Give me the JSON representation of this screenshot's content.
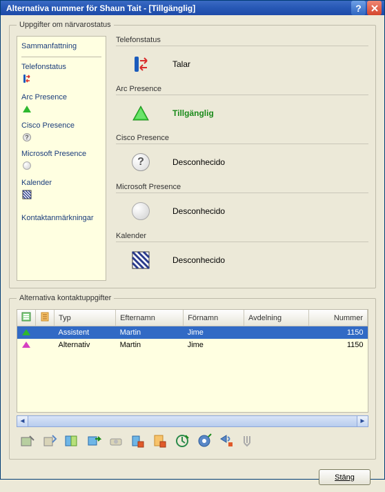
{
  "title": "Alternativa nummer för Shaun Tait - [Tillgänglig]",
  "group_presence_label": "Uppgifter om närvarostatus",
  "sidebar": {
    "summary": "Sammanfattning",
    "items": [
      {
        "label": "Telefonstatus"
      },
      {
        "label": "Arc Presence"
      },
      {
        "label": "Cisco Presence"
      },
      {
        "label": "Microsoft Presence"
      },
      {
        "label": "Kalender"
      },
      {
        "label": "Kontaktanmärkningar"
      }
    ]
  },
  "status": {
    "telefon": {
      "label": "Telefonstatus",
      "value": "Talar"
    },
    "arc": {
      "label": "Arc Presence",
      "value": "Tillgänglig"
    },
    "cisco": {
      "label": "Cisco Presence",
      "value": "Desconhecido"
    },
    "microsoft": {
      "label": "Microsoft Presence",
      "value": "Desconhecido"
    },
    "kalender": {
      "label": "Kalender",
      "value": "Desconhecido"
    }
  },
  "alt_group_label": "Alternativa kontaktuppgifter",
  "table": {
    "headers": {
      "typ": "Typ",
      "efternamn": "Efternamn",
      "fornamn": "Förnamn",
      "avdelning": "Avdelning",
      "nummer": "Nummer"
    },
    "rows": [
      {
        "typ": "Assistent",
        "efternamn": "Martin",
        "fornamn": "Jime",
        "avdelning": "",
        "nummer": "1150",
        "selected": true,
        "tri_color": "#2eb82e"
      },
      {
        "typ": "Alternativ",
        "efternamn": "Martin",
        "fornamn": "Jime",
        "avdelning": "",
        "nummer": "1150",
        "selected": false,
        "tri_color": "#d63fc1"
      }
    ]
  },
  "close_button": "Stäng"
}
